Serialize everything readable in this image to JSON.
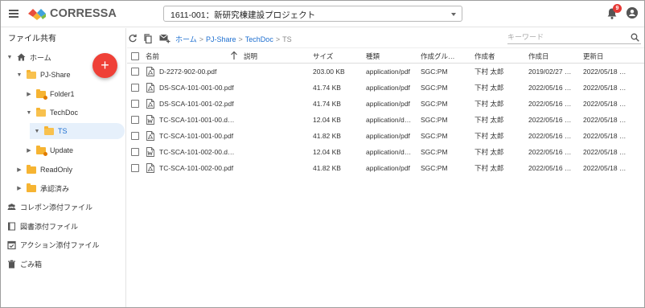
{
  "header": {
    "logo_text": "CORRESSA",
    "project": "1611-001：新研究棟建設プロジェクト",
    "notification_count": "9"
  },
  "sidebar": {
    "title": "ファイル共有",
    "tree": [
      {
        "label": "ホーム"
      },
      {
        "label": "PJ-Share"
      },
      {
        "label": "Folder1"
      },
      {
        "label": "TechDoc"
      },
      {
        "label": "TS"
      },
      {
        "label": "Update"
      },
      {
        "label": "ReadOnly"
      },
      {
        "label": "承認済み"
      }
    ],
    "links": [
      {
        "label": "コレポン添付ファイル"
      },
      {
        "label": "図書添付ファイル"
      },
      {
        "label": "アクション添付ファイル"
      },
      {
        "label": "ごみ箱"
      }
    ],
    "fab_label": "+"
  },
  "breadcrumb": {
    "items": [
      "ホーム",
      "PJ-Share",
      "TechDoc"
    ],
    "current": "TS",
    "separator": ">"
  },
  "search": {
    "placeholder": "キーワード"
  },
  "table": {
    "columns": [
      "名前",
      "説明",
      "サイズ",
      "種類",
      "作成グル…",
      "作成者",
      "作成日",
      "更新日"
    ],
    "rows": [
      {
        "icon": "pdf-icon",
        "name": "D-2272-902-00.pdf",
        "desc": "",
        "size": "203.00 KB",
        "type": "application/pdf",
        "group": "SGC:PM",
        "author": "下村 太郎",
        "created": "2019/02/27 …",
        "updated": "2022/05/18 …"
      },
      {
        "icon": "pdf-icon",
        "name": "DS-SCA-101-001-00.pdf",
        "desc": "",
        "size": "41.74 KB",
        "type": "application/pdf",
        "group": "SGC:PM",
        "author": "下村 太郎",
        "created": "2022/05/16 …",
        "updated": "2022/05/18 …"
      },
      {
        "icon": "pdf-icon",
        "name": "DS-SCA-101-001-02.pdf",
        "desc": "",
        "size": "41.74 KB",
        "type": "application/pdf",
        "group": "SGC:PM",
        "author": "下村 太郎",
        "created": "2022/05/16 …",
        "updated": "2022/05/18 …"
      },
      {
        "icon": "word-icon",
        "name": "TC-SCA-101-001-00.d…",
        "desc": "",
        "size": "12.04 KB",
        "type": "application/d…",
        "group": "SGC:PM",
        "author": "下村 太郎",
        "created": "2022/05/16 …",
        "updated": "2022/05/18 …"
      },
      {
        "icon": "pdf-icon",
        "name": "TC-SCA-101-001-00.pdf",
        "desc": "",
        "size": "41.82 KB",
        "type": "application/pdf",
        "group": "SGC:PM",
        "author": "下村 太郎",
        "created": "2022/05/16 …",
        "updated": "2022/05/18 …"
      },
      {
        "icon": "word-icon",
        "name": "TC-SCA-101-002-00.d…",
        "desc": "",
        "size": "12.04 KB",
        "type": "application/d…",
        "group": "SGC:PM",
        "author": "下村 太郎",
        "created": "2022/05/16 …",
        "updated": "2022/05/18 …"
      },
      {
        "icon": "pdf-icon",
        "name": "TC-SCA-101-002-00.pdf",
        "desc": "",
        "size": "41.82 KB",
        "type": "application/pdf",
        "group": "SGC:PM",
        "author": "下村 太郎",
        "created": "2022/05/16 …",
        "updated": "2022/05/18 …"
      }
    ]
  },
  "colors": {
    "accent": "#1e6fd0",
    "fab": "#ef4037",
    "folder": "#f6b432",
    "badge": "#e53935"
  }
}
